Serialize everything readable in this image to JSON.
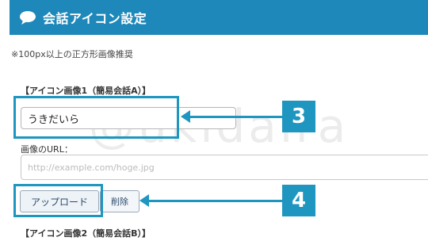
{
  "header": {
    "title": "会話アイコン設定",
    "icon": "speech-bubble-icon"
  },
  "note": "※100px以上の正方形画像推奨",
  "section1": {
    "label": "【アイコン画像1（簡易会話A）】",
    "name_value": "うきだいら",
    "url_label": "画像のURL：",
    "url_placeholder": "http://example.com/hoge.jpg",
    "upload_label": "アップロード",
    "delete_label": "削除"
  },
  "section2": {
    "label": "【アイコン画像2（簡易会話B）】"
  },
  "annotations": {
    "badge1": "3",
    "badge2": "4",
    "color": "#1e96c0"
  },
  "watermark": "@ukidaira"
}
